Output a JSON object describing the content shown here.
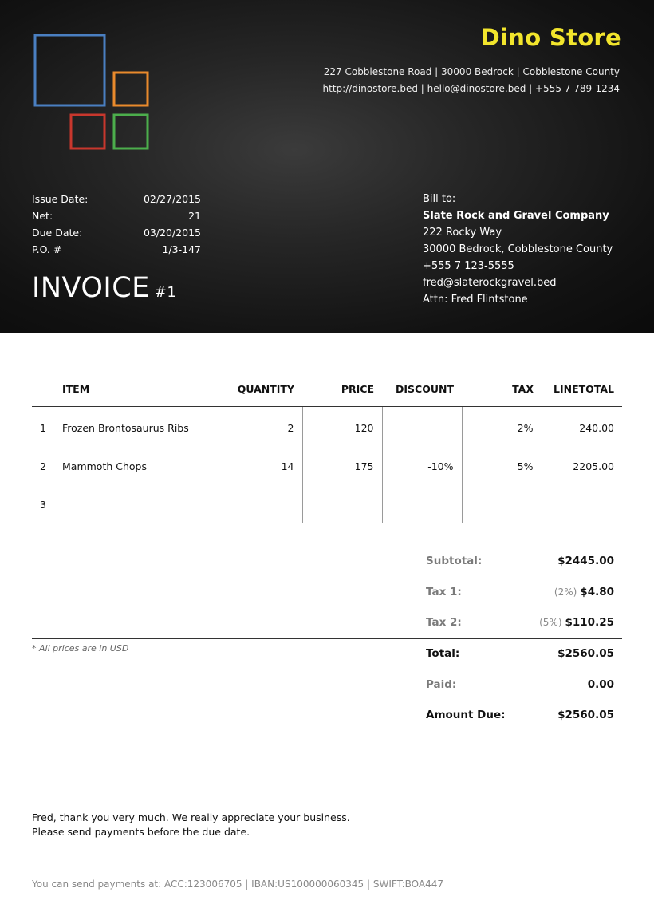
{
  "store": {
    "name": "Dino Store",
    "address_line": "227 Cobblestone Road | 30000 Bedrock | Cobblestone County",
    "contact_line": "http://dinostore.bed | hello@dinostore.bed | +555 7 789-1234",
    "logo_colors": [
      "#4a7fc1",
      "#e98a2c",
      "#c8372d",
      "#4cae4c"
    ],
    "accent_color": "#f2e52c"
  },
  "meta": [
    {
      "label": "Issue Date:",
      "value": "02/27/2015"
    },
    {
      "label": "Net:",
      "value": "21"
    },
    {
      "label": "Due Date:",
      "value": "03/20/2015"
    },
    {
      "label": "P.O. #",
      "value": "1/3-147"
    }
  ],
  "invoice": {
    "title": "INVOICE",
    "number": "#1"
  },
  "bill_to": {
    "label": "Bill to:",
    "company": "Slate Rock and Gravel Company",
    "street": "222 Rocky Way",
    "city": "30000 Bedrock, Cobblestone County",
    "phone": "+555 7 123-5555",
    "email": "fred@slaterockgravel.bed",
    "attn": "Attn: Fred Flintstone"
  },
  "table": {
    "headers": {
      "item": "ITEM",
      "quantity": "QUANTITY",
      "price": "PRICE",
      "discount": "DISCOUNT",
      "tax": "TAX",
      "linetotal": "LINETOTAL"
    },
    "rows": [
      {
        "num": "1",
        "item": "Frozen Brontosaurus Ribs",
        "quantity": "2",
        "price": "120",
        "discount": "",
        "tax": "2%",
        "linetotal": "240.00"
      },
      {
        "num": "2",
        "item": "Mammoth Chops",
        "quantity": "14",
        "price": "175",
        "discount": "-10%",
        "tax": "5%",
        "linetotal": "2205.00"
      },
      {
        "num": "3",
        "item": "",
        "quantity": "",
        "price": "",
        "discount": "",
        "tax": "",
        "linetotal": ""
      }
    ]
  },
  "totals": {
    "subtotal_label": "Subtotal:",
    "subtotal_value": "$2445.00",
    "tax1_label": "Tax 1:",
    "tax1_pct": "(2%)",
    "tax1_value": "$4.80",
    "tax2_label": "Tax 2:",
    "tax2_pct": "(5%)",
    "tax2_value": "$110.25",
    "total_label": "Total:",
    "total_value": "$2560.05",
    "paid_label": "Paid:",
    "paid_value": "0.00",
    "due_label": "Amount Due:",
    "due_value": "$2560.05"
  },
  "notes": {
    "currency": "* All prices are in USD",
    "thanks_line1": "Fred, thank you very much. We really appreciate your business.",
    "thanks_line2": "Please send payments before the due date.",
    "payment_info": "You can send payments at: ACC:123006705 | IBAN:US100000060345 | SWIFT:BOA447"
  }
}
